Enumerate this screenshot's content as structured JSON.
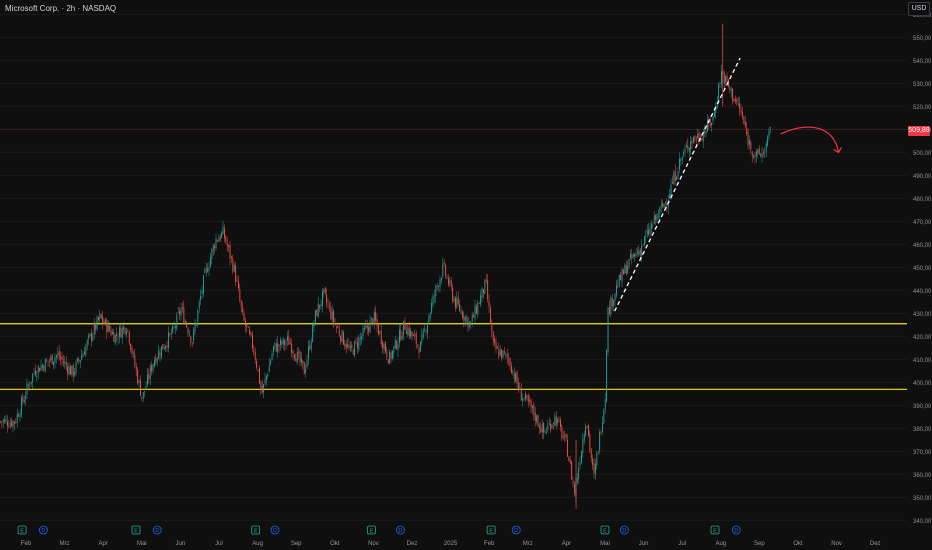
{
  "header": {
    "title": "Microsoft Corp. · 2h · NASDAQ",
    "currency": "USD"
  },
  "price_tag": "509,89",
  "colors": {
    "up": "#26a69a",
    "down": "#ef5350",
    "support": "#f2e51b",
    "trendline": "#ffffff",
    "arrow": "#f23645",
    "background": "#0f0f0f"
  },
  "chart_data": {
    "type": "candlestick",
    "title": "Microsoft Corp. · 2h · NASDAQ",
    "ylim": [
      338,
      562
    ],
    "y_ticks": [
      "340,00",
      "350,00",
      "360,00",
      "370,00",
      "380,00",
      "390,00",
      "400,00",
      "410,00",
      "420,00",
      "430,00",
      "440,00",
      "450,00",
      "460,00",
      "470,00",
      "480,00",
      "490,00",
      "500,00",
      "510,00",
      "520,00",
      "530,00",
      "540,00",
      "550,00",
      "560,00"
    ],
    "x_ticks": [
      "Feb",
      "Mrz",
      "Apr",
      "Mai",
      "Jun",
      "Jul",
      "Aug",
      "Sep",
      "Okt",
      "Nov",
      "Dez",
      "2025",
      "Feb",
      "Mrz",
      "Apr",
      "Mai",
      "Jun",
      "Jul",
      "Aug",
      "Sep",
      "Okt",
      "Nov",
      "Dez"
    ],
    "x_tick_month_index": [
      0,
      1,
      2,
      3,
      4,
      5,
      6,
      7,
      8,
      9,
      10,
      11,
      12,
      13,
      14,
      15,
      16,
      17,
      18,
      19,
      20,
      21,
      22
    ],
    "horizontal_levels": [
      425.5,
      397
    ],
    "last_price": 509.89,
    "anchors": [
      {
        "m": -0.3,
        "p": 383
      },
      {
        "m": 0.2,
        "p": 405
      },
      {
        "m": 0.8,
        "p": 412
      },
      {
        "m": 1.2,
        "p": 404
      },
      {
        "m": 1.9,
        "p": 428
      },
      {
        "m": 2.3,
        "p": 420
      },
      {
        "m": 2.6,
        "p": 425
      },
      {
        "m": 2.8,
        "p": 408
      },
      {
        "m": 3.0,
        "p": 393
      },
      {
        "m": 3.3,
        "p": 410
      },
      {
        "m": 3.8,
        "p": 422
      },
      {
        "m": 4.0,
        "p": 432
      },
      {
        "m": 4.3,
        "p": 418
      },
      {
        "m": 4.6,
        "p": 445
      },
      {
        "m": 4.9,
        "p": 462
      },
      {
        "m": 5.1,
        "p": 465
      },
      {
        "m": 5.4,
        "p": 448
      },
      {
        "m": 5.6,
        "p": 428
      },
      {
        "m": 5.9,
        "p": 414
      },
      {
        "m": 6.1,
        "p": 395
      },
      {
        "m": 6.4,
        "p": 415
      },
      {
        "m": 6.8,
        "p": 418
      },
      {
        "m": 7.2,
        "p": 405
      },
      {
        "m": 7.5,
        "p": 430
      },
      {
        "m": 7.7,
        "p": 438
      },
      {
        "m": 8.0,
        "p": 425
      },
      {
        "m": 8.4,
        "p": 413
      },
      {
        "m": 9.0,
        "p": 428
      },
      {
        "m": 9.4,
        "p": 410
      },
      {
        "m": 9.8,
        "p": 425
      },
      {
        "m": 10.2,
        "p": 415
      },
      {
        "m": 10.6,
        "p": 440
      },
      {
        "m": 10.8,
        "p": 450
      },
      {
        "m": 11.1,
        "p": 435
      },
      {
        "m": 11.5,
        "p": 425
      },
      {
        "m": 11.9,
        "p": 443
      },
      {
        "m": 12.1,
        "p": 415
      },
      {
        "m": 12.5,
        "p": 410
      },
      {
        "m": 12.8,
        "p": 395
      },
      {
        "m": 13.1,
        "p": 388
      },
      {
        "m": 13.4,
        "p": 378
      },
      {
        "m": 13.7,
        "p": 385
      },
      {
        "m": 14.0,
        "p": 372
      },
      {
        "m": 14.2,
        "p": 352
      },
      {
        "m": 14.5,
        "p": 385
      },
      {
        "m": 14.7,
        "p": 358
      },
      {
        "m": 15.0,
        "p": 395
      },
      {
        "m": 15.05,
        "p": 430
      },
      {
        "m": 15.3,
        "p": 442
      },
      {
        "m": 15.6,
        "p": 452
      },
      {
        "m": 15.9,
        "p": 458
      },
      {
        "m": 16.2,
        "p": 468
      },
      {
        "m": 16.6,
        "p": 480
      },
      {
        "m": 16.9,
        "p": 495
      },
      {
        "m": 17.2,
        "p": 505
      },
      {
        "m": 17.5,
        "p": 508
      },
      {
        "m": 17.8,
        "p": 515
      },
      {
        "m": 18.0,
        "p": 535
      },
      {
        "m": 18.2,
        "p": 528
      },
      {
        "m": 18.5,
        "p": 518
      },
      {
        "m": 18.7,
        "p": 505
      },
      {
        "m": 18.9,
        "p": 498
      },
      {
        "m": 19.1,
        "p": 500
      },
      {
        "m": 19.3,
        "p": 510
      }
    ]
  },
  "trendline": {
    "from": {
      "m": 15.25,
      "p": 431
    },
    "to": {
      "m": 18.5,
      "p": 541
    }
  },
  "projection_arrow": {
    "from": {
      "m": 19.55,
      "p": 508
    },
    "to": {
      "m": 21.05,
      "p": 500
    }
  },
  "events": [
    {
      "type": "E",
      "m": -0.1
    },
    {
      "type": "D",
      "m": 0.45
    },
    {
      "type": "E",
      "m": 2.85
    },
    {
      "type": "D",
      "m": 3.4
    },
    {
      "type": "E",
      "m": 5.95
    },
    {
      "type": "D",
      "m": 6.45
    },
    {
      "type": "E",
      "m": 8.95
    },
    {
      "type": "D",
      "m": 9.7
    },
    {
      "type": "E",
      "m": 12.05
    },
    {
      "type": "D",
      "m": 12.7
    },
    {
      "type": "E",
      "m": 15.0
    },
    {
      "type": "D",
      "m": 15.5
    },
    {
      "type": "E",
      "m": 17.85
    },
    {
      "type": "D",
      "m": 18.4
    }
  ]
}
